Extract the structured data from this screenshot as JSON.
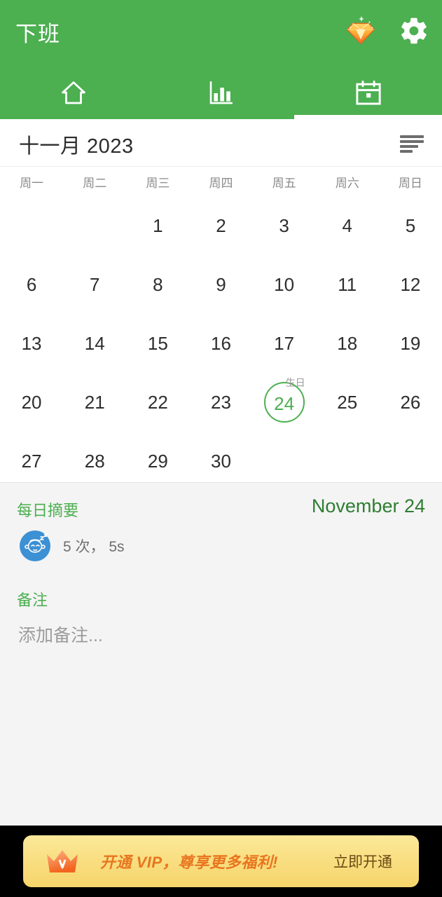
{
  "header": {
    "title": "下班",
    "vip_icon": "vip-gem-icon",
    "settings_icon": "gear-icon"
  },
  "tabs": [
    {
      "id": "home",
      "icon": "home-icon",
      "active": false
    },
    {
      "id": "stats",
      "icon": "bar-chart-icon",
      "active": false
    },
    {
      "id": "calendar",
      "icon": "calendar-icon",
      "active": true
    }
  ],
  "calendar": {
    "month_label": "十一月 2023",
    "list_view_icon": "list-icon",
    "weekdays": [
      "周一",
      "周二",
      "周三",
      "周四",
      "周五",
      "周六",
      "周日"
    ],
    "leading_blanks": 2,
    "days": [
      1,
      2,
      3,
      4,
      5,
      6,
      7,
      8,
      9,
      10,
      11,
      12,
      13,
      14,
      15,
      16,
      17,
      18,
      19,
      20,
      21,
      22,
      23,
      24,
      25,
      26,
      27,
      28,
      29,
      30
    ],
    "selected_day": 24,
    "day_tags": {
      "24": "生日"
    },
    "accent_color": "#4caf50"
  },
  "summary": {
    "section_title": "每日摘要",
    "date_label": "November 24",
    "stat_icon": "sleeping-baby-icon",
    "stat_text": "5 次， 5s",
    "notes_title": "备注",
    "notes_placeholder": "添加备注..."
  },
  "vip_banner": {
    "crown_icon": "crown-icon",
    "message": "开通 VIP，尊享更多福利!",
    "cta": "立即开通"
  }
}
